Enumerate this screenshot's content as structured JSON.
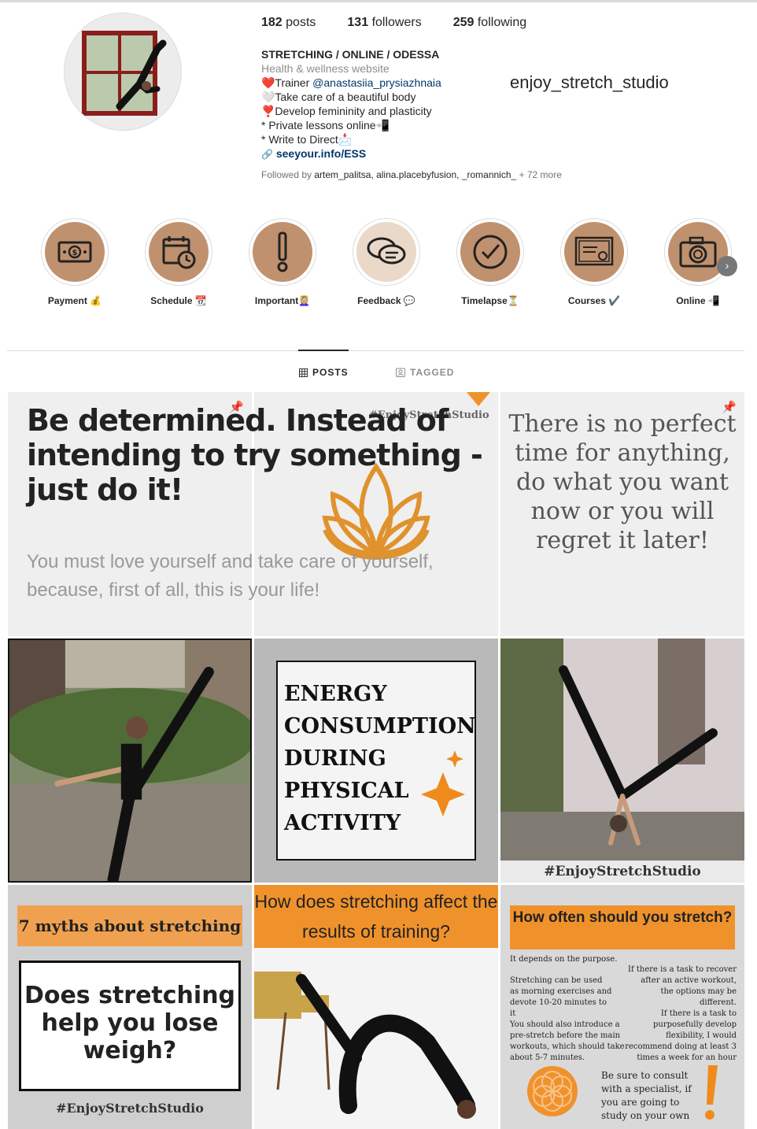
{
  "profile": {
    "username": "enjoy_stretch_studio",
    "stats": {
      "posts_count": "182",
      "posts_label": "posts",
      "followers_count": "131",
      "followers_label": "followers",
      "following_count": "259",
      "following_label": "following"
    },
    "bio": {
      "name": "STRETCHING / ONLINE / ODESSA",
      "category": "Health & wellness website",
      "line1_prefix": "❤️Trainer ",
      "line1_mention": "@anastasiia_prysiazhnaia",
      "line2": "🤍Take care of a beautiful body",
      "line3": "❣️Develop femininity and plasticity",
      "line4": "* Private lessons online📲",
      "line5": "* Write to Direct📩",
      "link": "seeyour.info/ESS"
    },
    "followed_by": {
      "prefix": "Followed by ",
      "users": "artem_palitsa, alina.placebyfusion, _romannich_",
      "more": " + 72 more"
    }
  },
  "highlights": [
    {
      "label": "Payment 💰",
      "icon": "money-icon"
    },
    {
      "label": "Schedule 📆",
      "icon": "calendar-clock-icon"
    },
    {
      "label": "Important💆🏼‍♀️",
      "icon": "exclamation-icon"
    },
    {
      "label": "Feedback 💬",
      "icon": "chat-bubbles-icon"
    },
    {
      "label": "Timelapse⏳",
      "icon": "check-circle-icon"
    },
    {
      "label": "Courses ✔️",
      "icon": "certificate-icon"
    },
    {
      "label": "Online 📲",
      "icon": "camera-icon"
    }
  ],
  "tabs": {
    "posts": "POSTS",
    "tagged": "TAGGED"
  },
  "posts": {
    "p1_big": "Be determined. Instead of intending to try something - just do it!",
    "p1_small": "You must love yourself and take care of yourself, because, first of all, this is your life!",
    "p2_tag": "#EnjoyStretchStudio",
    "p3_quote": "There is no perfect time for anything, do what you want now or you will regret it later!",
    "p5_text": "ENERGY CONSUMPTION DURING PHYSICAL ACTIVITY",
    "p6_tag": "#EnjoyStretchStudio",
    "p7_bar": "7 myths about stretching",
    "p7_box": "Does stretching help you lose weigh?",
    "p7_tag": "#EnjoyStretchStudio",
    "p8_head": "How does stretching affect the results of training?",
    "p9_head": "How often should you stretch?",
    "p9_t1": "It depends on the purpose.",
    "p9_t2": "If there is a task to recover after an active workout, the options may be different.",
    "p9_t3": "Stretching can be used as morning exercises and devote 10-20 minutes to it",
    "p9_t4": "If there is a task to purposefully develop flexibility, I would recommend doing at least 3 times a week for an hour",
    "p9_t5": "You should also introduce a pre-stretch before the main workouts, which should take about 5-7 minutes.",
    "p9_t6": "Be sure to consult with a specialist, if you are going to study on your own"
  },
  "colors": {
    "accent_orange": "#f0922b",
    "highlight_brown": "#c0916e",
    "link_blue": "#00376b"
  }
}
